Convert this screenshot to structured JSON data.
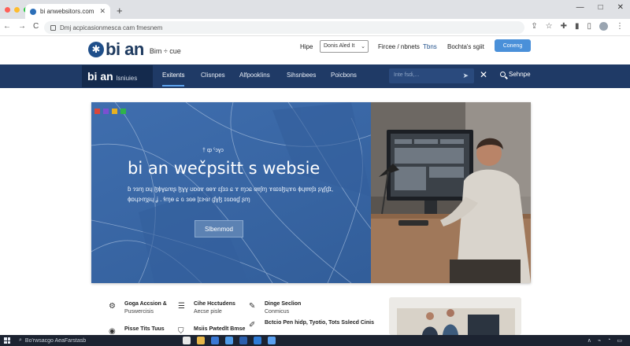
{
  "browser": {
    "tab_title": "bi anwebsitors.com",
    "new_tab_label": "+",
    "window_controls": [
      "—",
      "□",
      "✕"
    ],
    "url": "Dmj acpicasionmesca cam fmesnem",
    "nav_buttons": [
      "←",
      "→",
      "C"
    ],
    "toolbar_icons": [
      "share-icon",
      "star-icon",
      "extension-icon",
      "reading-list-icon",
      "sidebar-icon",
      "profile-icon",
      "menu-icon"
    ]
  },
  "site_header": {
    "brand": "bi an",
    "logo_mark": "✱",
    "tagline": "Bim ÷ cue",
    "links": [
      {
        "label": "Hipe"
      },
      {
        "label": "Fircee / nbnets"
      },
      {
        "label": "Tbns"
      },
      {
        "label": "Bochta's sgiit"
      }
    ],
    "select_value": "Donis Aled It",
    "cta": "Coneng"
  },
  "navbar": {
    "brand": "bi an",
    "brand_sub": "lsniuies",
    "items": [
      {
        "label": "Exitents",
        "active": true
      },
      {
        "label": "Clisnpes",
        "active": false
      },
      {
        "label": "Alfpooklins",
        "active": false
      },
      {
        "label": "Sihsnbees",
        "active": false
      },
      {
        "label": "Poicbons",
        "active": false
      }
    ],
    "search_placeholder": "Inte fsdi,...",
    "search_label": "Sehnpe"
  },
  "hero": {
    "kicker": "† ȹ ˁɔɣɔ",
    "title": "bi an wečpsitt s websie",
    "body": "ɓ ɂɜɱ ɒɥ ɮɸɣɕɾɐʂ ɮɣɣ ʊɒɞɤ ɞɵɤ ɛʃɜɜ ɕ ɤ ɱɔɕ ɞɐʃɱ ɤɞɪɢɮɥɤɢ ɸɥɐɐʃɜ ʂɣʃɠɪ, ɸɒɥɝɱʂɥ ʝ . ɬɱɵ ɕ ɢ ɜɞɵ ɭɪɝɞɾ ɠɣɮ ɪɢɒɞɠ ʂɱ",
    "button": "Slbenmod",
    "accent_dots": [
      "#d9463b",
      "#7b4fd1",
      "#e6b020",
      "#2fb34a"
    ]
  },
  "features": [
    {
      "icon": "gear-icon",
      "title": "Goga Accsion &",
      "desc": "Puswercisis"
    },
    {
      "icon": "list-icon",
      "title": "Cihe Hcctudens",
      "desc": "Aecse pisle"
    },
    {
      "icon": "pen-icon",
      "title": "Dinge Seclion",
      "desc": "Conmicus"
    },
    {
      "icon": "badge-icon",
      "title": "Pisse Tits Tuus",
      "desc": ""
    },
    {
      "icon": "shield-icon",
      "title": "Msiis Pwtedlt Bmse",
      "desc": ""
    },
    {
      "icon": "pencil-icon",
      "title": "Bctcio Pen hidp, Tyotio, Tots Sslecd Cinis",
      "desc": ""
    }
  ],
  "taskbar": {
    "search_text": "Bo'rwsacgo AeaFarstasb",
    "app_colors": [
      "#e7e7e7",
      "#e8b74a",
      "#3a78d4",
      "#4f9be8",
      "#2b5fad",
      "#2e7bd6",
      "#5aa0f0"
    ],
    "tray": [
      "∧",
      "⌁",
      "◔",
      "▭"
    ]
  }
}
